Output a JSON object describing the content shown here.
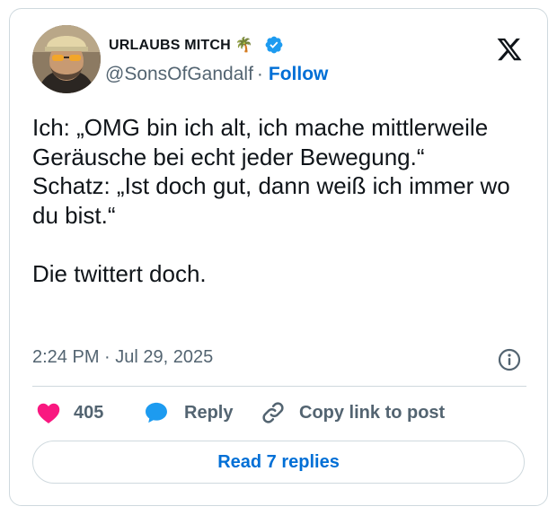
{
  "author": {
    "display_name": "URLAUBS MITCH 🌴",
    "handle": "@SonsOfGandalf",
    "separator": "·",
    "follow_label": "Follow",
    "verified": true
  },
  "tweet": {
    "text": "Ich: „OMG bin ich alt, ich mache mittlerweile Geräusche bei echt jeder Bewegung.“\nSchatz: „Ist doch gut, dann weiß ich immer wo du bist.“\n\nDie twittert doch.",
    "timestamp": "2:24 PM · Jul 29, 2025"
  },
  "actions": {
    "like_count": "405",
    "reply_label": "Reply",
    "copy_link_label": "Copy link to post"
  },
  "read_replies_label": "Read 7 replies",
  "colors": {
    "like": "#f91880",
    "reply": "#1d9bf0",
    "link": "#006fd6",
    "secondary_text": "#536471",
    "border": "#cfd9de"
  },
  "icons": [
    "verified-badge-icon",
    "x-logo-icon",
    "info-icon",
    "heart-icon",
    "reply-bubble-icon",
    "link-icon"
  ]
}
